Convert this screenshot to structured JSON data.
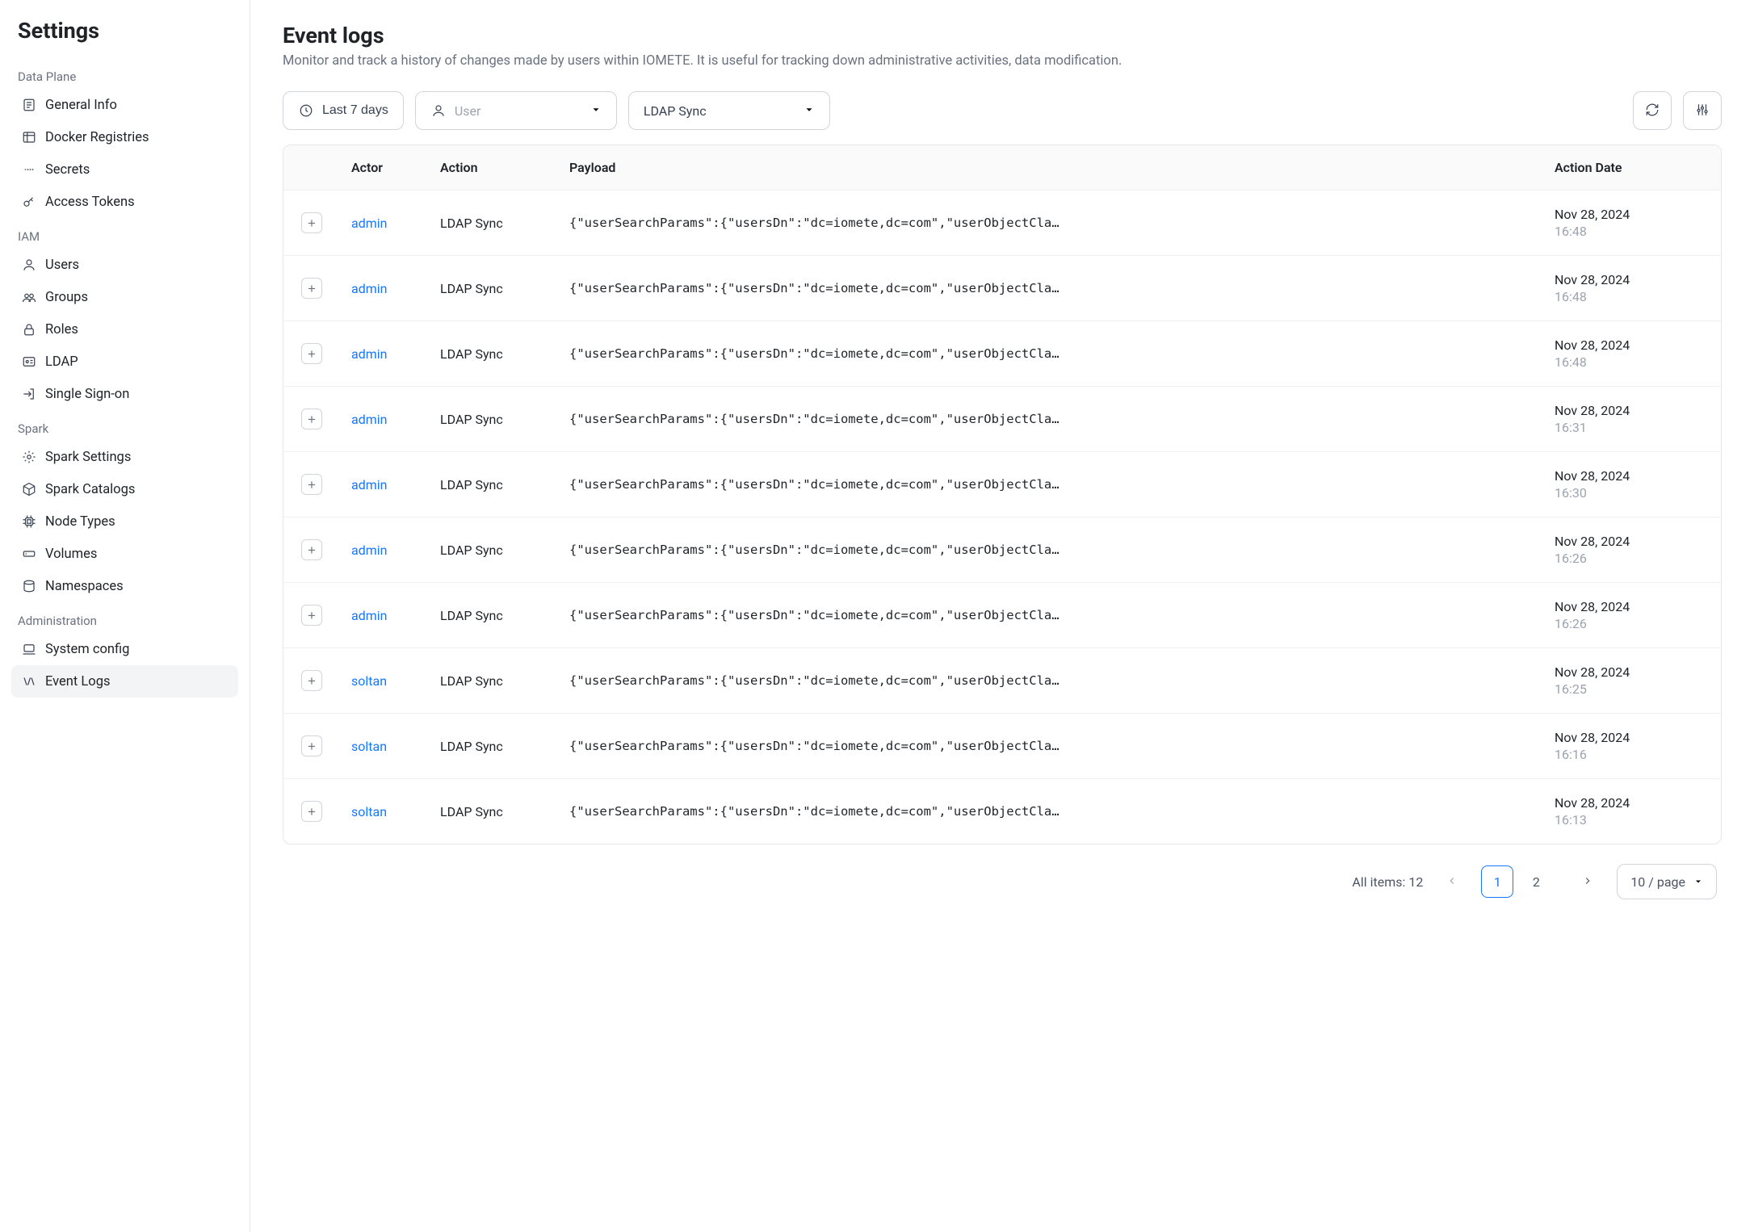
{
  "sidebar": {
    "title": "Settings",
    "groups": [
      {
        "label": "Data Plane",
        "items": [
          {
            "id": "general-info",
            "label": "General Info",
            "icon": "info"
          },
          {
            "id": "docker-registries",
            "label": "Docker Registries",
            "icon": "registry"
          },
          {
            "id": "secrets",
            "label": "Secrets",
            "icon": "secrets"
          },
          {
            "id": "access-tokens",
            "label": "Access Tokens",
            "icon": "key"
          }
        ]
      },
      {
        "label": "IAM",
        "items": [
          {
            "id": "users",
            "label": "Users",
            "icon": "user"
          },
          {
            "id": "groups",
            "label": "Groups",
            "icon": "group"
          },
          {
            "id": "roles",
            "label": "Roles",
            "icon": "lock"
          },
          {
            "id": "ldap",
            "label": "LDAP",
            "icon": "idcard"
          },
          {
            "id": "sso",
            "label": "Single Sign-on",
            "icon": "login"
          }
        ]
      },
      {
        "label": "Spark",
        "items": [
          {
            "id": "spark-settings",
            "label": "Spark Settings",
            "icon": "gear"
          },
          {
            "id": "spark-catalogs",
            "label": "Spark Catalogs",
            "icon": "box"
          },
          {
            "id": "node-types",
            "label": "Node Types",
            "icon": "cpu"
          },
          {
            "id": "volumes",
            "label": "Volumes",
            "icon": "volume"
          },
          {
            "id": "namespaces",
            "label": "Namespaces",
            "icon": "namespace"
          }
        ]
      },
      {
        "label": "Administration",
        "items": [
          {
            "id": "system-config",
            "label": "System config",
            "icon": "laptop"
          },
          {
            "id": "event-logs",
            "label": "Event Logs",
            "icon": "logs",
            "active": true
          }
        ]
      }
    ]
  },
  "page": {
    "title": "Event logs",
    "subtitle": "Monitor and track a history of changes made by users within IOMETE. It is useful for tracking down administrative activities, data modification."
  },
  "filters": {
    "date_range": "Last 7 days",
    "user_placeholder": "User",
    "action_selected": "LDAP Sync"
  },
  "table": {
    "headers": {
      "actor": "Actor",
      "action": "Action",
      "payload": "Payload",
      "action_date": "Action Date"
    },
    "rows": [
      {
        "actor": "admin",
        "action": "LDAP Sync",
        "payload": "{\"userSearchParams\":{\"usersDn\":\"dc=iomete,dc=com\",\"userObjectCla…",
        "date": "Nov 28, 2024",
        "time": "16:48"
      },
      {
        "actor": "admin",
        "action": "LDAP Sync",
        "payload": "{\"userSearchParams\":{\"usersDn\":\"dc=iomete,dc=com\",\"userObjectCla…",
        "date": "Nov 28, 2024",
        "time": "16:48"
      },
      {
        "actor": "admin",
        "action": "LDAP Sync",
        "payload": "{\"userSearchParams\":{\"usersDn\":\"dc=iomete,dc=com\",\"userObjectCla…",
        "date": "Nov 28, 2024",
        "time": "16:48"
      },
      {
        "actor": "admin",
        "action": "LDAP Sync",
        "payload": "{\"userSearchParams\":{\"usersDn\":\"dc=iomete,dc=com\",\"userObjectCla…",
        "date": "Nov 28, 2024",
        "time": "16:31"
      },
      {
        "actor": "admin",
        "action": "LDAP Sync",
        "payload": "{\"userSearchParams\":{\"usersDn\":\"dc=iomete,dc=com\",\"userObjectCla…",
        "date": "Nov 28, 2024",
        "time": "16:30"
      },
      {
        "actor": "admin",
        "action": "LDAP Sync",
        "payload": "{\"userSearchParams\":{\"usersDn\":\"dc=iomete,dc=com\",\"userObjectCla…",
        "date": "Nov 28, 2024",
        "time": "16:26"
      },
      {
        "actor": "admin",
        "action": "LDAP Sync",
        "payload": "{\"userSearchParams\":{\"usersDn\":\"dc=iomete,dc=com\",\"userObjectCla…",
        "date": "Nov 28, 2024",
        "time": "16:26"
      },
      {
        "actor": "soltan",
        "action": "LDAP Sync",
        "payload": "{\"userSearchParams\":{\"usersDn\":\"dc=iomete,dc=com\",\"userObjectCla…",
        "date": "Nov 28, 2024",
        "time": "16:25"
      },
      {
        "actor": "soltan",
        "action": "LDAP Sync",
        "payload": "{\"userSearchParams\":{\"usersDn\":\"dc=iomete,dc=com\",\"userObjectCla…",
        "date": "Nov 28, 2024",
        "time": "16:16"
      },
      {
        "actor": "soltan",
        "action": "LDAP Sync",
        "payload": "{\"userSearchParams\":{\"usersDn\":\"dc=iomete,dc=com\",\"userObjectCla…",
        "date": "Nov 28, 2024",
        "time": "16:13"
      }
    ]
  },
  "pagination": {
    "total_label": "All items: 12",
    "pages": [
      "1",
      "2"
    ],
    "current": "1",
    "page_size_label": "10 / page"
  }
}
